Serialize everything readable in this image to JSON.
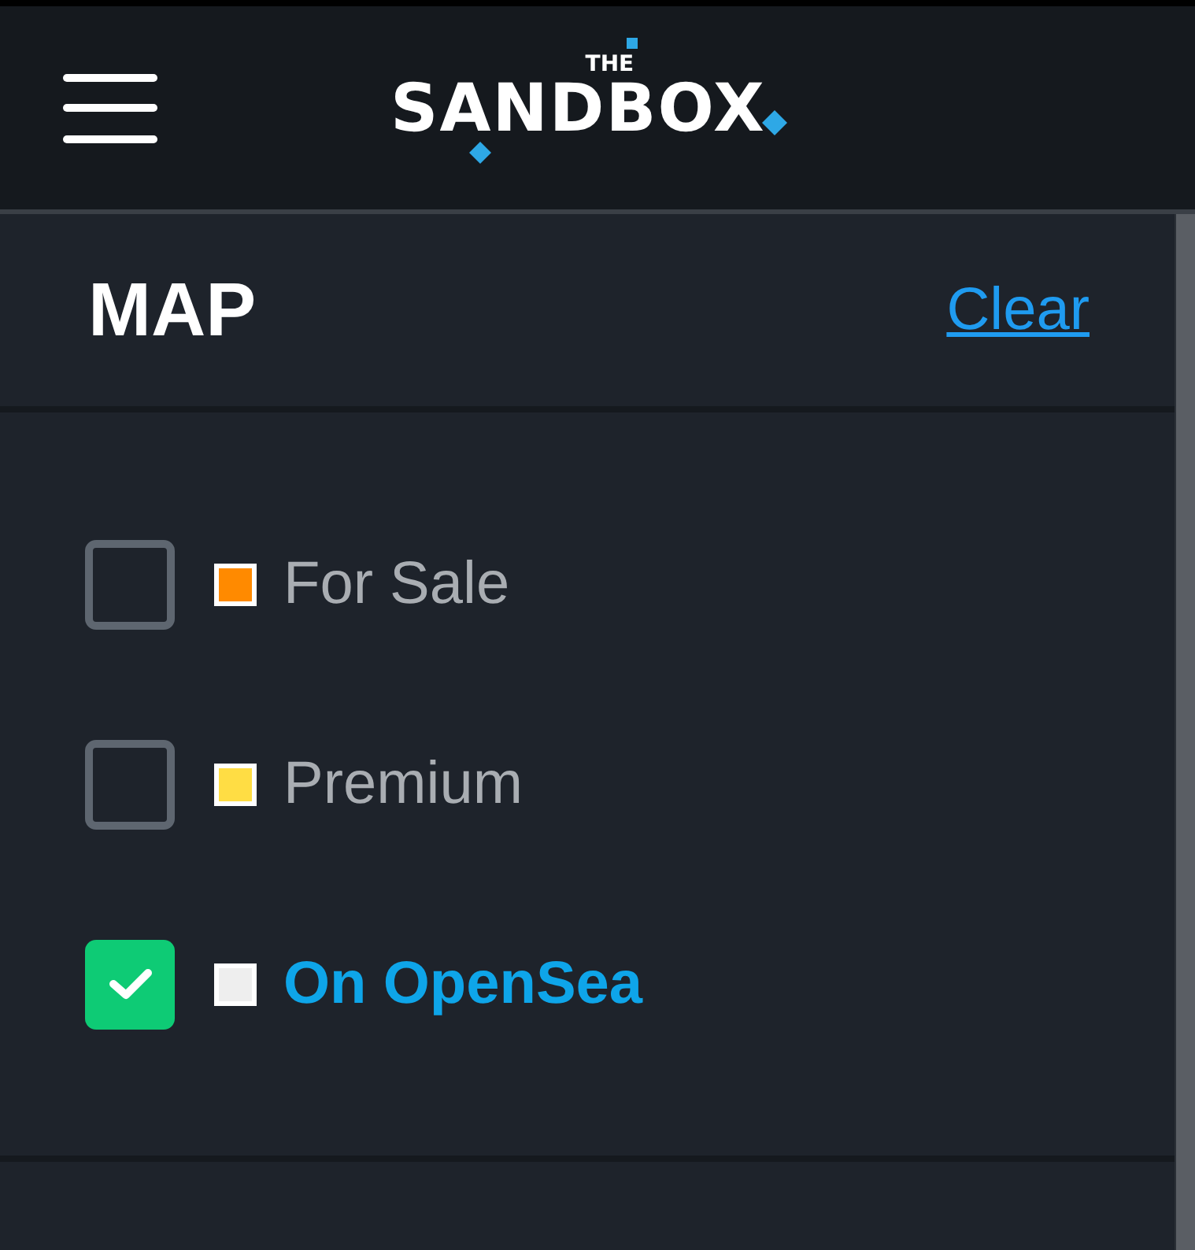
{
  "header": {
    "logo_small": "THE",
    "logo_main": "SANDBOX"
  },
  "panel": {
    "title": "MAP",
    "clear_link": "Clear"
  },
  "filters": [
    {
      "label": "For Sale",
      "checked": false,
      "color": "#ff8a00"
    },
    {
      "label": "Premium",
      "checked": false,
      "color": "#ffdd44"
    },
    {
      "label": "On OpenSea",
      "checked": true,
      "color": "#eeeeee"
    }
  ]
}
